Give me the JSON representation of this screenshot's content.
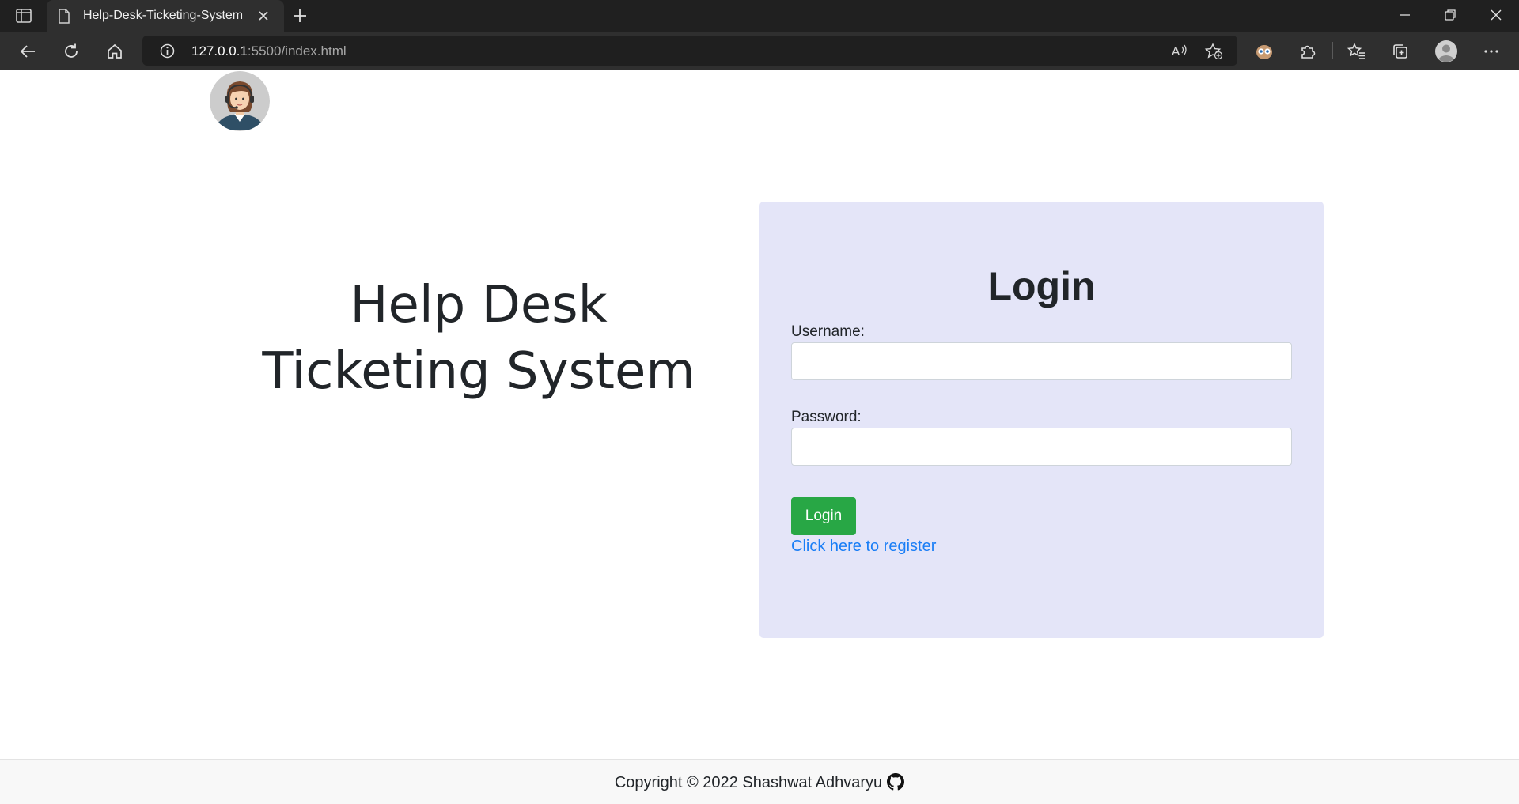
{
  "browser": {
    "tab_title": "Help-Desk-Ticketing-System",
    "url_host": "127.0.0.1",
    "url_path": ":5500/index.html"
  },
  "page": {
    "hero_line1": "Help Desk",
    "hero_line2": "Ticketing System",
    "login_title": "Login",
    "username_label": "Username:",
    "username_value": "",
    "password_label": "Password:",
    "password_value": "",
    "login_button": "Login",
    "register_link": "Click here to register"
  },
  "footer": {
    "copyright": "Copyright © 2022 Shashwat Adhvaryu"
  },
  "colors": {
    "card_bg": "#e4e5f8",
    "button_green": "#28a745",
    "link_blue": "#1a7ef6",
    "chrome_dark": "#202020"
  },
  "icons": [
    "sidebar-tabs-icon",
    "page-icon",
    "close-icon",
    "plus-icon",
    "minimize-icon",
    "restore-icon",
    "window-close-icon",
    "back-icon",
    "refresh-icon",
    "home-icon",
    "info-icon",
    "read-aloud-icon",
    "add-favorite-icon",
    "extension-owl-icon",
    "extensions-icon",
    "favorites-icon",
    "collections-icon",
    "profile-icon",
    "more-icon",
    "github-icon"
  ]
}
